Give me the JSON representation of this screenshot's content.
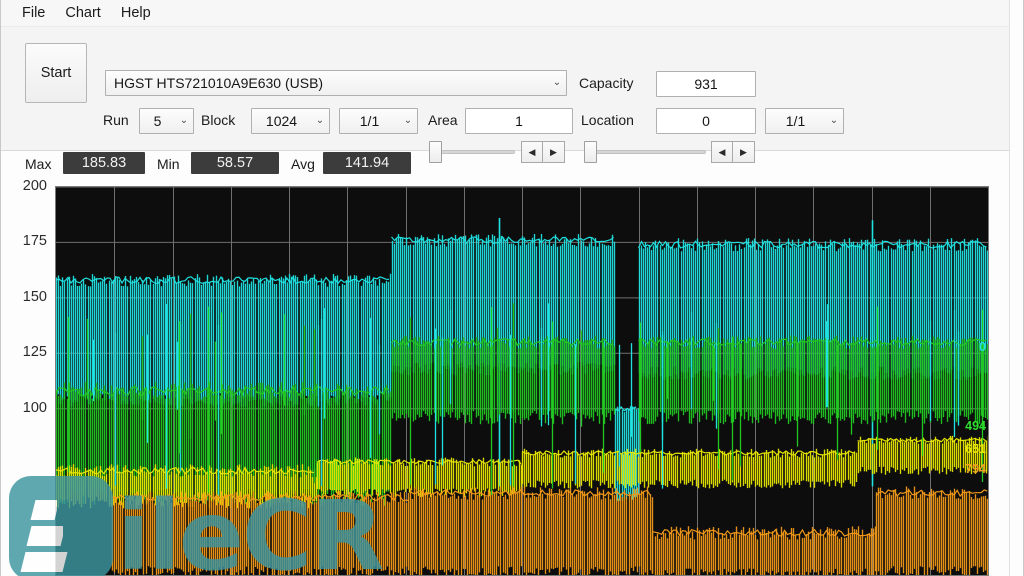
{
  "window": {
    "menu": [
      {
        "label": "File",
        "name": "menu-file"
      },
      {
        "label": "Chart",
        "name": "menu-chart"
      },
      {
        "label": "Help",
        "name": "menu-help"
      }
    ]
  },
  "toolbar": {
    "start_label": "Start",
    "device": {
      "label": "",
      "value": "HGST HTS721010A9E630 (USB)"
    },
    "capacity": {
      "label": "Capacity",
      "value": "931"
    },
    "run": {
      "label": "Run",
      "value": "5"
    },
    "block": {
      "label": "Block",
      "value": "1024"
    },
    "block_part": {
      "value": "1/1"
    },
    "area": {
      "label": "Area",
      "value": "1"
    },
    "location": {
      "label": "Location",
      "value": "0"
    },
    "location_part": {
      "value": "1/1"
    },
    "chevron": "⌄",
    "arrow_left": "◀",
    "arrow_right": "▶"
  },
  "stats": {
    "max": {
      "label": "Max",
      "value": "185.83"
    },
    "min": {
      "label": "Min",
      "value": "58.57"
    },
    "avg": {
      "label": "Avg",
      "value": "141.94"
    }
  },
  "chart_data": {
    "type": "line",
    "title": "",
    "xlabel": "",
    "ylabel": "",
    "ylim": [
      25,
      200
    ],
    "yticks": [
      200,
      175,
      150,
      125,
      100
    ],
    "ytick_labels": [
      "200",
      "175",
      "150",
      "125",
      "100"
    ],
    "grid": true,
    "legend_position": "none",
    "x_gridlines": 15,
    "background": "#0d0d0d",
    "gridline_color": "#6f6f6f",
    "right_value_labels": [
      {
        "text": "0",
        "color": "#20e0e0",
        "y_value": 128
      },
      {
        "text": "494",
        "color": "#2ee02e",
        "y_value": 92
      },
      {
        "text": "651",
        "color": "#e6e600",
        "y_value": 82
      },
      {
        "text": "794",
        "color": "#f0a020",
        "y_value": 73
      }
    ],
    "series": [
      {
        "name": "read-speed-cyan",
        "color": "#20e0e0",
        "units": "MB/s",
        "segments": [
          {
            "x_start": 0,
            "x_end": 0.36,
            "top": 158,
            "bottom": 104,
            "noise": 3
          },
          {
            "x_start": 0.36,
            "x_end": 0.6,
            "top": 176,
            "bottom": 118,
            "noise": 3
          },
          {
            "x_start": 0.6,
            "x_end": 0.625,
            "top": 100,
            "bottom": 60,
            "noise": 2
          },
          {
            "x_start": 0.625,
            "x_end": 1.0,
            "top": 174,
            "bottom": 116,
            "noise": 3
          }
        ],
        "spikes": [
          {
            "x": 0.475,
            "value": 186
          },
          {
            "x": 0.875,
            "value": 185
          }
        ]
      },
      {
        "name": "series-green",
        "color": "#22c722",
        "units": "MB/s",
        "segments": [
          {
            "x_start": 0,
            "x_end": 0.36,
            "top": 108,
            "bottom": 60,
            "noise": 4
          },
          {
            "x_start": 0.36,
            "x_end": 0.6,
            "top": 130,
            "bottom": 96,
            "noise": 3
          },
          {
            "x_start": 0.625,
            "x_end": 1.0,
            "top": 130,
            "bottom": 96,
            "noise": 3
          }
        ]
      },
      {
        "name": "series-yellow",
        "color": "#e6e600",
        "units": "MB/s",
        "segments": [
          {
            "x_start": 0,
            "x_end": 0.28,
            "top": 72,
            "bottom": 58,
            "noise": 3
          },
          {
            "x_start": 0.28,
            "x_end": 0.5,
            "top": 76,
            "bottom": 62,
            "noise": 2
          },
          {
            "x_start": 0.5,
            "x_end": 0.86,
            "top": 80,
            "bottom": 66,
            "noise": 2
          },
          {
            "x_start": 0.86,
            "x_end": 1.0,
            "top": 86,
            "bottom": 72,
            "noise": 2
          }
        ]
      },
      {
        "name": "series-orange",
        "color": "#f09818",
        "units": "MB/s",
        "segments": [
          {
            "x_start": 0.06,
            "x_end": 0.38,
            "top": 60,
            "bottom": 26,
            "noise": 3
          },
          {
            "x_start": 0.38,
            "x_end": 0.64,
            "top": 62,
            "bottom": 26,
            "noise": 3
          },
          {
            "x_start": 0.64,
            "x_end": 0.88,
            "top": 44,
            "bottom": 25,
            "noise": 3
          },
          {
            "x_start": 0.88,
            "x_end": 1.0,
            "top": 62,
            "bottom": 26,
            "noise": 3
          }
        ]
      }
    ]
  },
  "watermark": {
    "text": "ileCR",
    "color": "#3e96a0"
  }
}
